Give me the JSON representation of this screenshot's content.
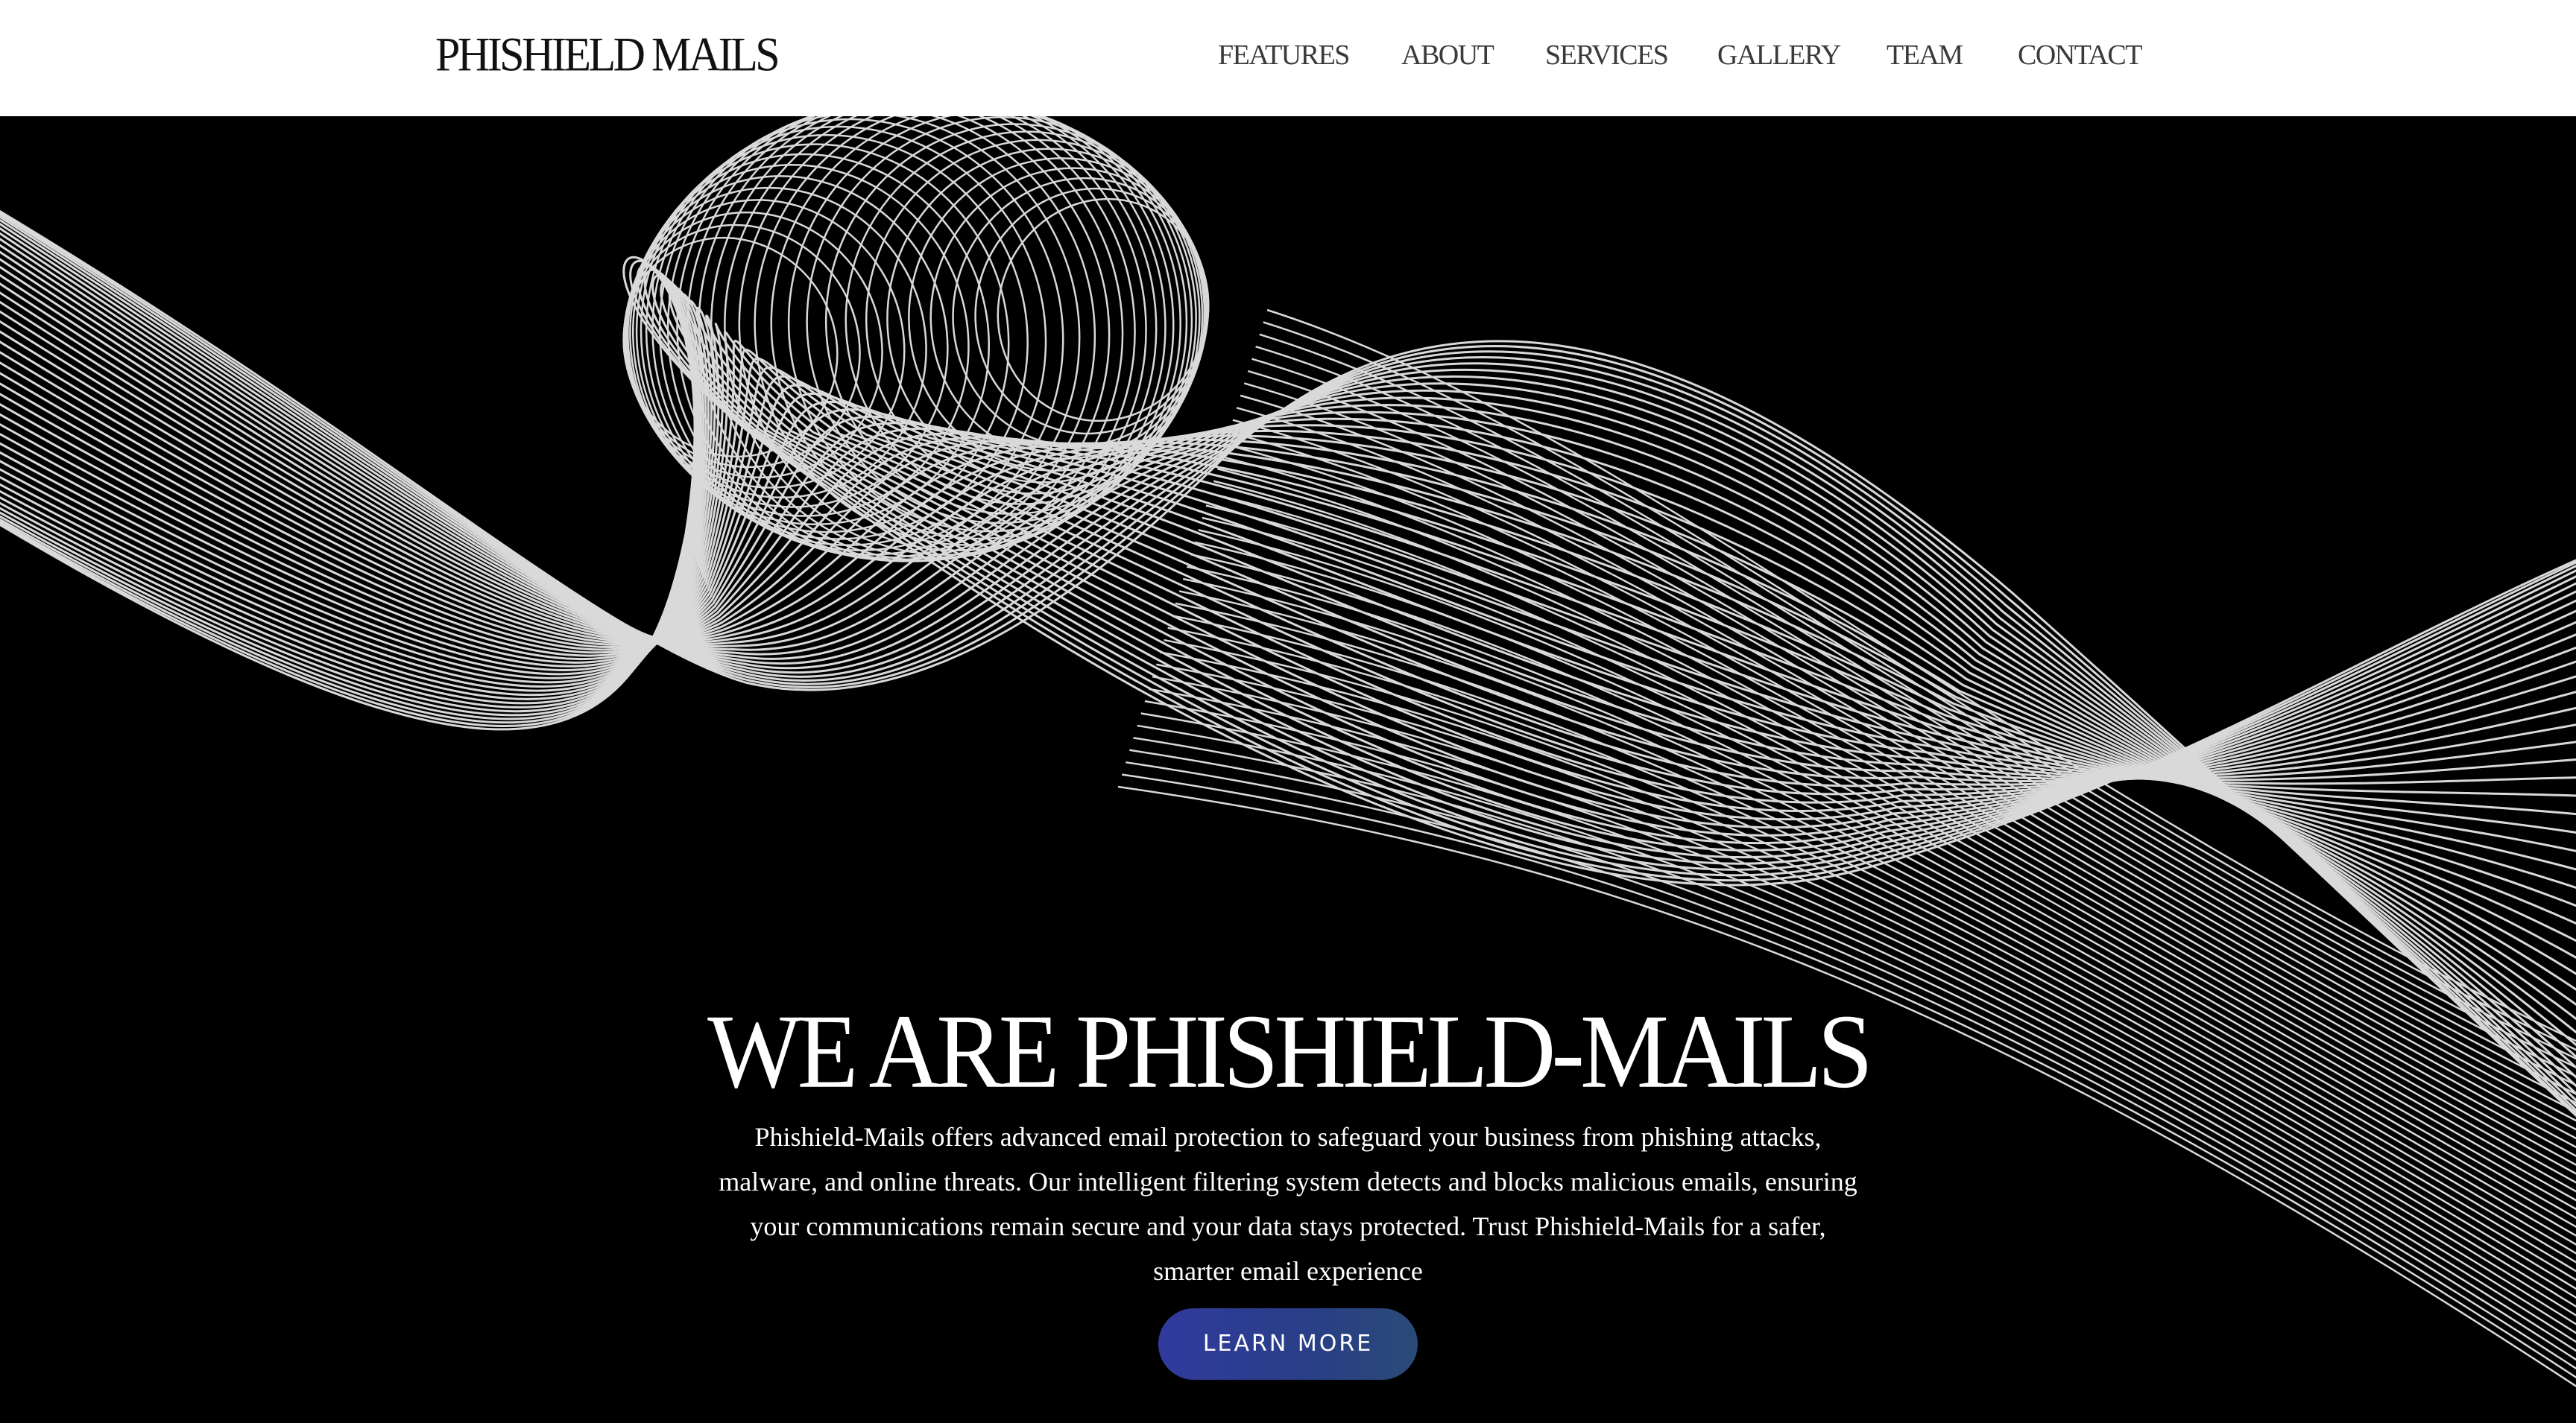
{
  "header": {
    "logo": "PHISHIELD MAILS",
    "nav": [
      {
        "label": "FEATURES"
      },
      {
        "label": "ABOUT"
      },
      {
        "label": "SERVICES"
      },
      {
        "label": "GALLERY"
      },
      {
        "label": "TEAM"
      },
      {
        "label": "CONTACT"
      }
    ]
  },
  "hero": {
    "title": "WE ARE PHISHIELD-MAILS",
    "description": "Phishield-Mails offers advanced email protection to safeguard your business from phishing attacks, malware, and online threats. Our intelligent filtering system detects and blocks malicious emails, ensuring your communications remain secure and your data stays protected. Trust Phishield-Mails for a safer, smarter email experience",
    "cta_label": "LEARN MORE",
    "background_art": "wave-lines-art"
  },
  "colors": {
    "header_bg": "#ffffff",
    "hero_bg": "#000000",
    "wave_lines": "#d9d9d9",
    "cta_bg": "#2f3b97",
    "text_light": "#ffffff",
    "nav_text": "#3a3a3a"
  }
}
